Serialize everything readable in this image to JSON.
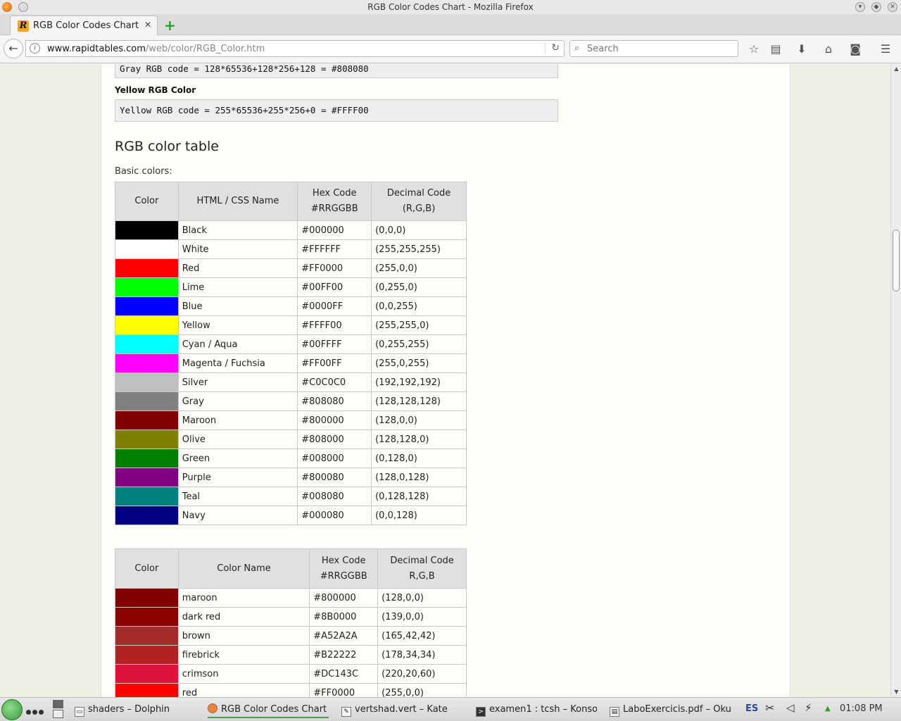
{
  "window": {
    "title": "RGB Color Codes Chart - Mozilla Firefox"
  },
  "tab": {
    "favicon": "R",
    "label": "RGB Color Codes Chart",
    "close_icon": "✕",
    "new_tab_icon": "+"
  },
  "navbar": {
    "url_host": "www.rapidtables.com",
    "url_path": "/web/color/RGB_Color.htm",
    "search_placeholder": "Search"
  },
  "content": {
    "gray_code": "Gray RGB code = 128*65536+128*256+128 = #808080",
    "yellow_heading": "Yellow RGB Color",
    "yellow_code": "Yellow RGB code = 255*65536+255*256+0 = #FFFF00",
    "table_heading": "RGB color table",
    "basic_label": "Basic colors:"
  },
  "basic_table": {
    "headers": {
      "color": "Color",
      "name": "HTML / CSS Name",
      "hex": "Hex Code",
      "hex_sub": "#RRGGBB",
      "dec": "Decimal Code",
      "dec_sub": "(R,G,B)"
    },
    "rows": [
      {
        "swatch": "#000000",
        "name": "Black",
        "hex": "#000000",
        "dec": "(0,0,0)"
      },
      {
        "swatch": "#FFFFFF",
        "name": "White",
        "hex": "#FFFFFF",
        "dec": "(255,255,255)"
      },
      {
        "swatch": "#FF0000",
        "name": "Red",
        "hex": "#FF0000",
        "dec": "(255,0,0)"
      },
      {
        "swatch": "#00FF00",
        "name": "Lime",
        "hex": "#00FF00",
        "dec": "(0,255,0)"
      },
      {
        "swatch": "#0000FF",
        "name": "Blue",
        "hex": "#0000FF",
        "dec": "(0,0,255)"
      },
      {
        "swatch": "#FFFF00",
        "name": "Yellow",
        "hex": "#FFFF00",
        "dec": "(255,255,0)"
      },
      {
        "swatch": "#00FFFF",
        "name": "Cyan / Aqua",
        "hex": "#00FFFF",
        "dec": "(0,255,255)"
      },
      {
        "swatch": "#FF00FF",
        "name": "Magenta / Fuchsia",
        "hex": "#FF00FF",
        "dec": "(255,0,255)"
      },
      {
        "swatch": "#C0C0C0",
        "name": "Silver",
        "hex": "#C0C0C0",
        "dec": "(192,192,192)"
      },
      {
        "swatch": "#808080",
        "name": "Gray",
        "hex": "#808080",
        "dec": "(128,128,128)"
      },
      {
        "swatch": "#800000",
        "name": "Maroon",
        "hex": "#800000",
        "dec": "(128,0,0)"
      },
      {
        "swatch": "#808000",
        "name": "Olive",
        "hex": "#808000",
        "dec": "(128,128,0)"
      },
      {
        "swatch": "#008000",
        "name": "Green",
        "hex": "#008000",
        "dec": "(0,128,0)"
      },
      {
        "swatch": "#800080",
        "name": "Purple",
        "hex": "#800080",
        "dec": "(128,0,128)"
      },
      {
        "swatch": "#008080",
        "name": "Teal",
        "hex": "#008080",
        "dec": "(0,128,128)"
      },
      {
        "swatch": "#000080",
        "name": "Navy",
        "hex": "#000080",
        "dec": "(0,0,128)"
      }
    ]
  },
  "named_table": {
    "headers": {
      "color": "Color",
      "name": "Color Name",
      "hex": "Hex Code",
      "hex_sub": "#RRGGBB",
      "dec": "Decimal Code",
      "dec_sub": "R,G,B"
    },
    "rows": [
      {
        "swatch": "#800000",
        "name": "maroon",
        "hex": "#800000",
        "dec": "(128,0,0)"
      },
      {
        "swatch": "#8B0000",
        "name": "dark red",
        "hex": "#8B0000",
        "dec": "(139,0,0)"
      },
      {
        "swatch": "#A52A2A",
        "name": "brown",
        "hex": "#A52A2A",
        "dec": "(165,42,42)"
      },
      {
        "swatch": "#B22222",
        "name": "firebrick",
        "hex": "#B22222",
        "dec": "(178,34,34)"
      },
      {
        "swatch": "#DC143C",
        "name": "crimson",
        "hex": "#DC143C",
        "dec": "(220,20,60)"
      },
      {
        "swatch": "#FF0000",
        "name": "red",
        "hex": "#FF0000",
        "dec": "(255,0,0)"
      }
    ]
  },
  "taskbar": {
    "tasks": [
      {
        "label": "shaders – Dolphin",
        "icon": "folder-icon"
      },
      {
        "label": "RGB Color Codes Chart ...",
        "icon": "firefox-icon"
      },
      {
        "label": "vertshad.vert – Kate",
        "icon": "kate-icon"
      },
      {
        "label": "examen1 : tcsh – Konsole",
        "icon": "terminal-icon"
      },
      {
        "label": "LaboExercicis.pdf – Okular",
        "icon": "okular-icon"
      }
    ],
    "lang": "ES",
    "clock": "01:08 PM"
  }
}
